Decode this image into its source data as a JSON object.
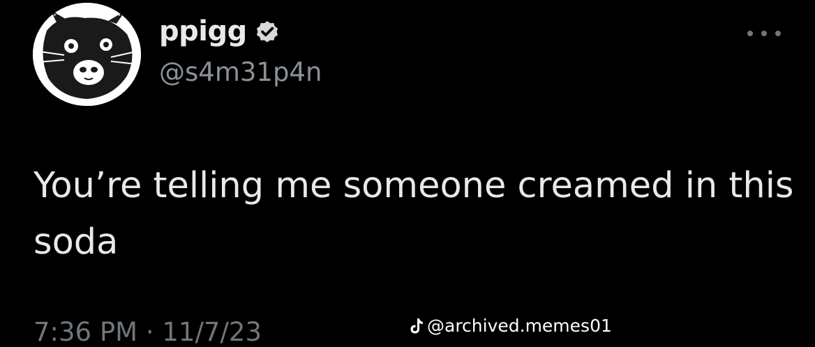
{
  "user": {
    "display_name": "ppigg",
    "handle": "@s4m31p4n",
    "verified": true
  },
  "tweet": {
    "text": "You’re telling me someone creamed in this soda",
    "timestamp": "7:36 PM · 11/7/23"
  },
  "watermark": {
    "icon": "tiktok-icon",
    "text": "@archived.memes01"
  },
  "colors": {
    "background": "#000000",
    "text": "#e7e9ea",
    "secondary": "#71767b",
    "verified_badge": "#d9d9d9"
  },
  "icons": {
    "more": "more-horizontal-icon",
    "verified": "verified-badge-icon"
  }
}
